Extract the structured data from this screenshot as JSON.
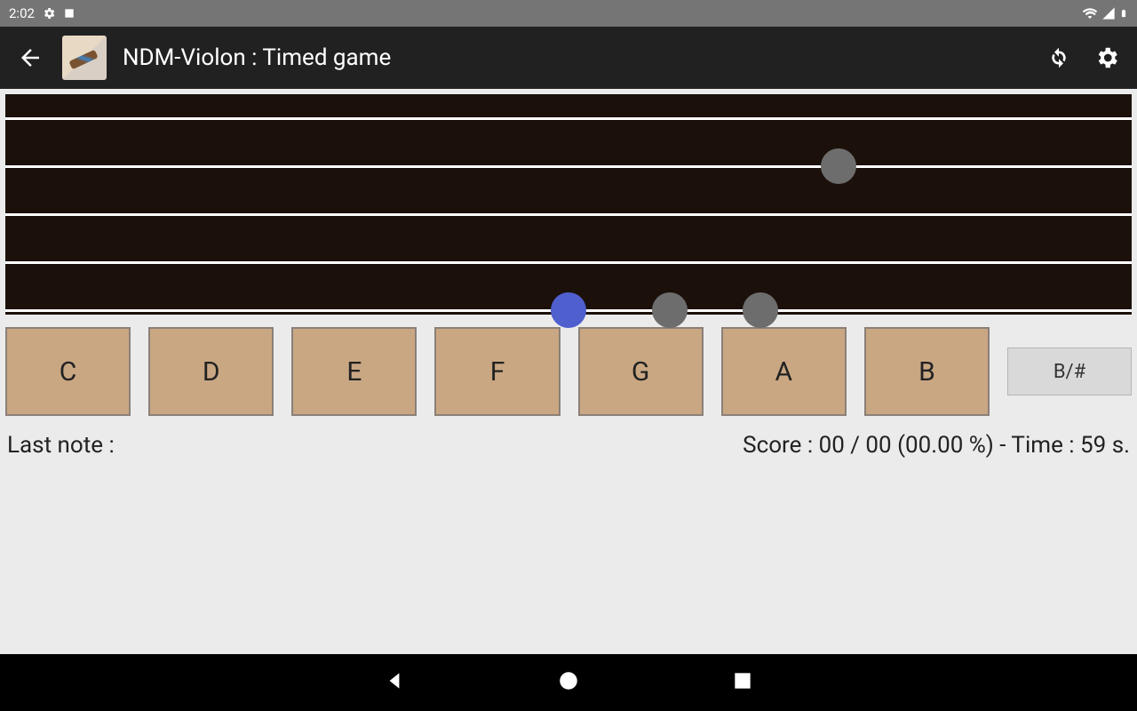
{
  "status": {
    "time": "2:02"
  },
  "app": {
    "title": "NDM-Violon : Timed game"
  },
  "fretboard": {
    "strings_y": [
      26,
      80,
      134,
      188,
      242
    ],
    "notes": [
      {
        "x_pct": 74,
        "string": 1,
        "color": "grey"
      },
      {
        "x_pct": 50,
        "string": 4,
        "color": "blue"
      },
      {
        "x_pct": 59,
        "string": 4,
        "color": "grey"
      },
      {
        "x_pct": 67,
        "string": 4,
        "color": "grey"
      }
    ]
  },
  "buttons": [
    "C",
    "D",
    "E",
    "F",
    "G",
    "A",
    "B"
  ],
  "flat_sharp": "B/#",
  "info": {
    "last_note_label": "Last note :",
    "last_note_value": "",
    "score_text": "Score :  00 / 00 (00.00 %)  - Time :  59  s."
  }
}
